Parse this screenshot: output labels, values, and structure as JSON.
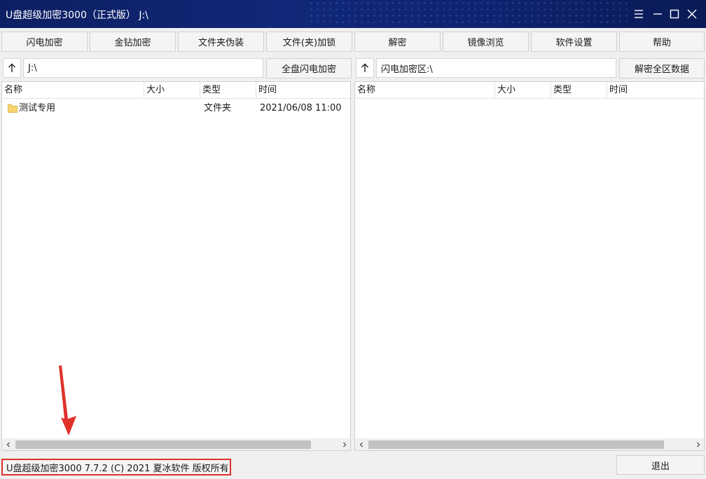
{
  "window": {
    "title": "U盘超级加密3000（正式版） J:\\"
  },
  "toolbar": [
    {
      "label": "闪电加密"
    },
    {
      "label": "金钻加密"
    },
    {
      "label": "文件夹伪装"
    },
    {
      "label": "文件(夹)加锁"
    },
    {
      "label": "解密"
    },
    {
      "label": "镜像浏览"
    },
    {
      "label": "软件设置"
    },
    {
      "label": "帮助"
    }
  ],
  "left": {
    "up_icon": "arrow-up-icon",
    "path": "J:\\",
    "action_label": "全盘闪电加密",
    "columns": [
      "名称",
      "大小",
      "类型",
      "时间"
    ],
    "rows": [
      {
        "name": "测试专用",
        "size": "",
        "type": "文件夹",
        "time": "2021/06/08 11:00"
      }
    ]
  },
  "right": {
    "up_icon": "arrow-up-icon",
    "path": "闪电加密区:\\",
    "action_label": "解密全区数据",
    "columns": [
      "名称",
      "大小",
      "类型",
      "时间"
    ]
  },
  "status": {
    "text": "U盘超级加密3000 7.7.2 (C) 2021 夏冰软件 版权所有"
  },
  "exit_label": "退出",
  "colors": {
    "title_bg": "#112878",
    "annotation": "#e0302a",
    "folder": "#f5d46e"
  }
}
